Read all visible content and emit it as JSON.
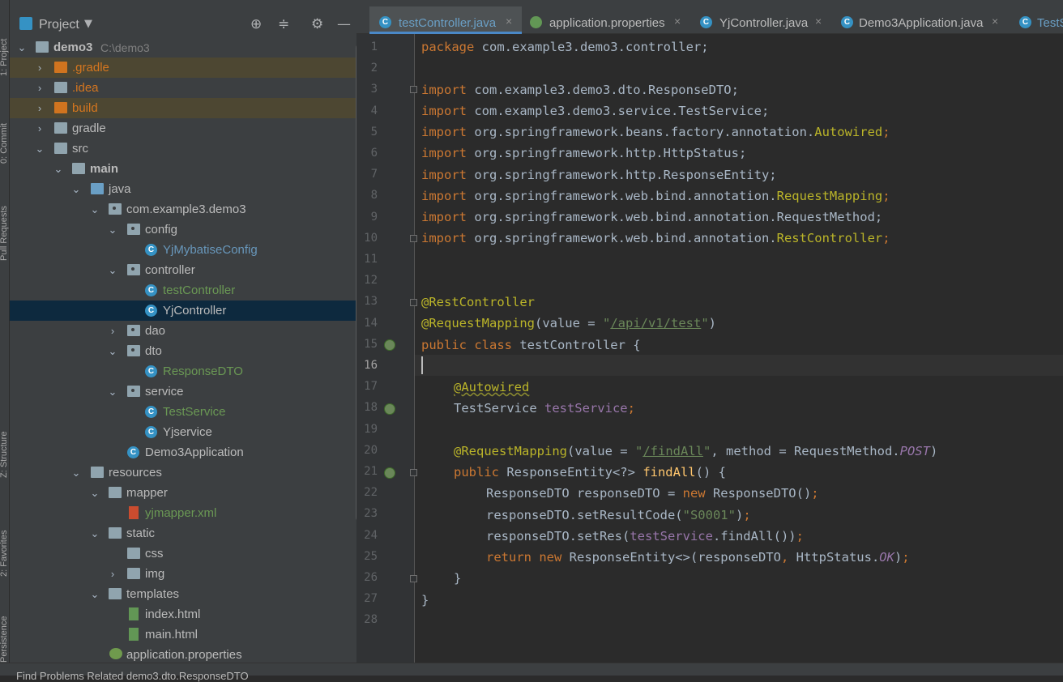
{
  "side_strip": {
    "project": "1: Project",
    "commit": "0: Commit",
    "pull_requests": "Pull Requests",
    "structure": "Z: Structure",
    "favorites": "2: Favorites",
    "persistence": "Persistence"
  },
  "project_panel": {
    "title": "Project",
    "tree": [
      {
        "label": "demo3",
        "path": "C:\\demo3",
        "style": "bold"
      },
      {
        "label": ".gradle",
        "style": "orange"
      },
      {
        "label": ".idea",
        "style": "orange"
      },
      {
        "label": "build",
        "style": "orange"
      },
      {
        "label": "gradle",
        "style": "norm"
      },
      {
        "label": "src",
        "style": "norm"
      },
      {
        "label": "main",
        "style": "bold"
      },
      {
        "label": "java",
        "style": "norm"
      },
      {
        "label": "com.example3.demo3",
        "style": "norm"
      },
      {
        "label": "config",
        "style": "norm"
      },
      {
        "label": "YjMybatiseConfig",
        "style": "teal"
      },
      {
        "label": "controller",
        "style": "norm"
      },
      {
        "label": "testController",
        "style": "green"
      },
      {
        "label": "YjController",
        "style": "norm"
      },
      {
        "label": "dao",
        "style": "norm"
      },
      {
        "label": "dto",
        "style": "norm"
      },
      {
        "label": "ResponseDTO",
        "style": "green"
      },
      {
        "label": "service",
        "style": "norm"
      },
      {
        "label": "TestService",
        "style": "green"
      },
      {
        "label": "Yjservice",
        "style": "norm"
      },
      {
        "label": "Demo3Application",
        "style": "norm"
      },
      {
        "label": "resources",
        "style": "norm"
      },
      {
        "label": "mapper",
        "style": "norm"
      },
      {
        "label": "yjmapper.xml",
        "style": "green"
      },
      {
        "label": "static",
        "style": "norm"
      },
      {
        "label": "css",
        "style": "norm"
      },
      {
        "label": "img",
        "style": "norm"
      },
      {
        "label": "templates",
        "style": "norm"
      },
      {
        "label": "index.html",
        "style": "norm"
      },
      {
        "label": "main.html",
        "style": "norm"
      },
      {
        "label": "application.properties",
        "style": "norm"
      }
    ]
  },
  "tabs": [
    {
      "label": "testController.java"
    },
    {
      "label": "application.properties"
    },
    {
      "label": "YjController.java"
    },
    {
      "label": "Demo3Application.java"
    },
    {
      "label": "TestS"
    }
  ],
  "editor": {
    "line_numbers": [
      "1",
      "2",
      "3",
      "4",
      "5",
      "6",
      "7",
      "8",
      "9",
      "10",
      "11",
      "12",
      "13",
      "14",
      "15",
      "16",
      "17",
      "18",
      "19",
      "20",
      "21",
      "22",
      "23",
      "24",
      "25",
      "26",
      "27",
      "28"
    ],
    "current_line": "16",
    "code": {
      "l1_kw": "package",
      "l1_rest": " com.example3.demo3.controller;",
      "kw_import": "import",
      "l3": " com.example3.demo3.dto.ResponseDTO;",
      "l4": " com.example3.demo3.service.TestService;",
      "l5_a": " org.springframework.beans.factory.annotation.",
      "l5_b": "Autowired",
      "l5_c": ";",
      "l6": " org.springframework.http.HttpStatus;",
      "l7": " org.springframework.http.ResponseEntity;",
      "l8_a": " org.springframework.web.bind.annotation.",
      "l8_b": "RequestMapping",
      "l8_c": ";",
      "l9": " org.springframework.web.bind.annotation.RequestMethod;",
      "l10_a": " org.springframework.web.bind.annotation.",
      "l10_b": "RestController",
      "l10_c": ";",
      "l13": "@RestController",
      "l14_a": "@RequestMapping",
      "l14_b": "(value = ",
      "l14_q1": "\"",
      "l14_path": "/api/v1/test",
      "l14_q2": "\"",
      "l14_c": ")",
      "l15_kw": "public class",
      "l15_rest": " testController {",
      "l17": "@Autowired",
      "l18_a": "TestService ",
      "l18_b": "testService",
      "l18_c": ";",
      "l20_a": "@RequestMapping",
      "l20_b": "(value = ",
      "l20_q1": "\"",
      "l20_path": "/findAll",
      "l20_q2": "\"",
      "l20_c": ", method = RequestMethod.",
      "l20_d": "POST",
      "l20_e": ")",
      "l21_kw": "public",
      "l21_a": " ResponseEntity<?> ",
      "l21_m": "findAll",
      "l21_b": "() {",
      "l22_a": "ResponseDTO responseDTO = ",
      "l22_kw": "new",
      "l22_b": " ResponseDTO()",
      "l22_c": ";",
      "l23_a": "responseDTO.setResultCode(",
      "l23_s": "\"S0001\"",
      "l23_b": ")",
      "l23_c": ";",
      "l24_a": "responseDTO.setRes(",
      "l24_f": "testService",
      "l24_b": ".findAll())",
      "l24_c": ";",
      "l25_kw": "return new",
      "l25_a": " ResponseEntity<>(responseDTO",
      "l25_comma": ",",
      "l25_b": " HttpStatus.",
      "l25_ok": "OK",
      "l25_c": ")",
      "l25_d": ";",
      "l26": "}",
      "l27": "}"
    }
  },
  "bottom_bar": {
    "text": "Find    Problems    Related    demo3.dto.ResponseDTO"
  },
  "colors": {
    "editor_bg": "#2b2b2b",
    "panel_bg": "#3c3f41",
    "keyword": "#cc7832",
    "annotation": "#bbb529",
    "string": "#6a8759",
    "field": "#9876aa",
    "selection": "#0d293e"
  }
}
